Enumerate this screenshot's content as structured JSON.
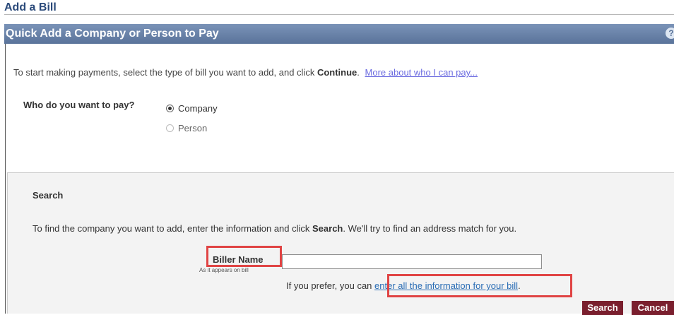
{
  "page": {
    "title": "Add a Bill"
  },
  "header": {
    "title": "Quick Add a Company or Person to Pay",
    "help_icon": "help-icon"
  },
  "intro": {
    "text_before": "To start making payments, select the type of bill you want to add, and click ",
    "continue_word": "Continue",
    "text_after": ".",
    "link": "More about who I can pay..."
  },
  "who": {
    "label": "Who do you want to pay?",
    "options": [
      {
        "label": "Company",
        "selected": true
      },
      {
        "label": "Person",
        "selected": false
      }
    ]
  },
  "search": {
    "title": "Search",
    "desc_before": "To find the company you want to add, enter the information and click ",
    "desc_bold": "Search",
    "desc_after": ". We'll try to find an address match for you.",
    "biller_label": "Biller Name",
    "biller_hint": "As it appears on bill",
    "biller_value": "",
    "prefer_text": "If you prefer, you can ",
    "prefer_link": "enter all the information for your bill",
    "prefer_end": ".",
    "search_button": "Search",
    "cancel_button": "Cancel"
  },
  "colors": {
    "header_bg": "#6a83aa",
    "panel_bg": "#f3f3f3",
    "button_bg": "#7a1f2e",
    "highlight": "#e04444",
    "link": "#2a6db5"
  }
}
